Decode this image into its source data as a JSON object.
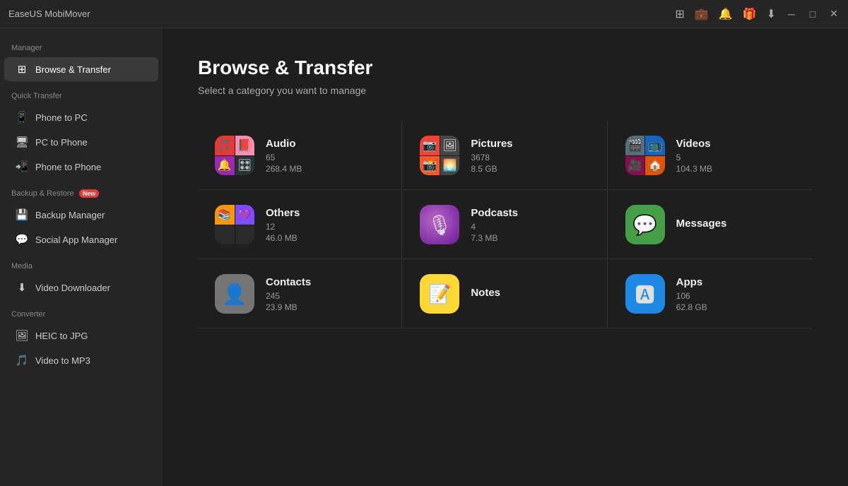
{
  "app": {
    "title": "EaseUS MobiMover"
  },
  "titlebar": {
    "controls": [
      "device-icon",
      "wallet-icon",
      "bell-icon",
      "gift-icon",
      "download-icon",
      "minimize-icon",
      "maximize-icon",
      "close-icon"
    ]
  },
  "sidebar": {
    "manager_label": "Manager",
    "quick_transfer_label": "Quick Transfer",
    "backup_label": "Backup & Restore",
    "media_label": "Media",
    "converter_label": "Converter",
    "items": [
      {
        "id": "browse-transfer",
        "label": "Browse & Transfer",
        "active": true,
        "section": "manager"
      },
      {
        "id": "phone-to-pc",
        "label": "Phone to PC",
        "active": false,
        "section": "quick"
      },
      {
        "id": "pc-to-phone",
        "label": "PC to Phone",
        "active": false,
        "section": "quick"
      },
      {
        "id": "phone-to-phone",
        "label": "Phone to Phone",
        "active": false,
        "section": "quick"
      },
      {
        "id": "backup-manager",
        "label": "Backup Manager",
        "active": false,
        "section": "backup"
      },
      {
        "id": "social-app-manager",
        "label": "Social App Manager",
        "active": false,
        "section": "backup"
      },
      {
        "id": "video-downloader",
        "label": "Video Downloader",
        "active": false,
        "section": "media"
      },
      {
        "id": "heic-to-jpg",
        "label": "HEIC to JPG",
        "active": false,
        "section": "converter"
      },
      {
        "id": "video-to-mp3",
        "label": "Video to MP3",
        "active": false,
        "section": "converter"
      }
    ]
  },
  "content": {
    "title": "Browse & Transfer",
    "subtitle": "Select a category you want to manage",
    "categories": [
      {
        "id": "audio",
        "name": "Audio",
        "count": "65",
        "size": "268.4 MB",
        "icon_type": "grid",
        "color": "audio"
      },
      {
        "id": "pictures",
        "name": "Pictures",
        "count": "3678",
        "size": "8.5 GB",
        "icon_type": "grid",
        "color": "pics"
      },
      {
        "id": "videos",
        "name": "Videos",
        "count": "5",
        "size": "104.3 MB",
        "icon_type": "grid",
        "color": "vid"
      },
      {
        "id": "others",
        "name": "Others",
        "count": "12",
        "size": "46.0 MB",
        "icon_type": "others",
        "color": "oth"
      },
      {
        "id": "podcasts",
        "name": "Podcasts",
        "count": "4",
        "size": "7.3 MB",
        "icon_type": "single",
        "bg": "#8e24aa",
        "emoji": "🎙"
      },
      {
        "id": "messages",
        "name": "Messages",
        "count": "",
        "size": "",
        "icon_type": "single",
        "bg": "#43a047",
        "emoji": "💬"
      },
      {
        "id": "contacts",
        "name": "Contacts",
        "count": "245",
        "size": "23.9 MB",
        "icon_type": "single",
        "bg": "#9e9e9e",
        "emoji": "👤"
      },
      {
        "id": "notes",
        "name": "Notes",
        "count": "",
        "size": "",
        "icon_type": "single",
        "bg": "#fdd835",
        "emoji": "📝"
      },
      {
        "id": "apps",
        "name": "Apps",
        "count": "106",
        "size": "62.8 GB",
        "icon_type": "single",
        "bg": "#1e88e5",
        "emoji": "📱"
      }
    ]
  }
}
